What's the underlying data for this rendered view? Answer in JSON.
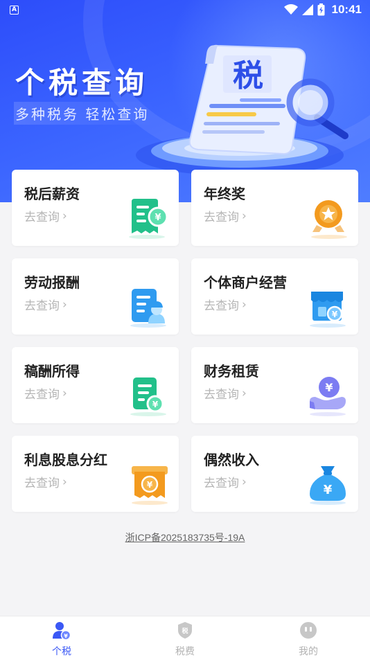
{
  "status_bar": {
    "time": "10:41",
    "app_badge": "A"
  },
  "hero": {
    "title": "个税查询",
    "subtitle": "多种税务 轻松查询",
    "doc_char": "税"
  },
  "cards": [
    {
      "title": "税后薪资",
      "link": "去查询",
      "icon": "salary-receipt-icon"
    },
    {
      "title": "年终奖",
      "link": "去查询",
      "icon": "medal-icon"
    },
    {
      "title": "劳动报酬",
      "link": "去查询",
      "icon": "worker-doc-icon"
    },
    {
      "title": "个体商户经营",
      "link": "去查询",
      "icon": "shop-icon"
    },
    {
      "title": "稿酬所得",
      "link": "去查询",
      "icon": "manuscript-icon"
    },
    {
      "title": "财务租赁",
      "link": "去查询",
      "icon": "coin-hand-icon"
    },
    {
      "title": "利息股息分红",
      "link": "去查询",
      "icon": "dividend-ticket-icon"
    },
    {
      "title": "偶然收入",
      "link": "去查询",
      "icon": "money-bag-icon"
    }
  ],
  "icp": "浙ICP备2025183735号-19A",
  "nav": [
    {
      "label": "个税",
      "icon": "person-tax-icon",
      "active": true
    },
    {
      "label": "税费",
      "icon": "shield-tax-icon",
      "active": false
    },
    {
      "label": "我的",
      "icon": "face-icon",
      "active": false
    }
  ],
  "colors": {
    "primary": "#3b58f5",
    "hero": "#3a63ff",
    "green": "#22c08a",
    "orange": "#f39a1e",
    "blue": "#2f9bf0",
    "purple": "#7c7cf2"
  }
}
